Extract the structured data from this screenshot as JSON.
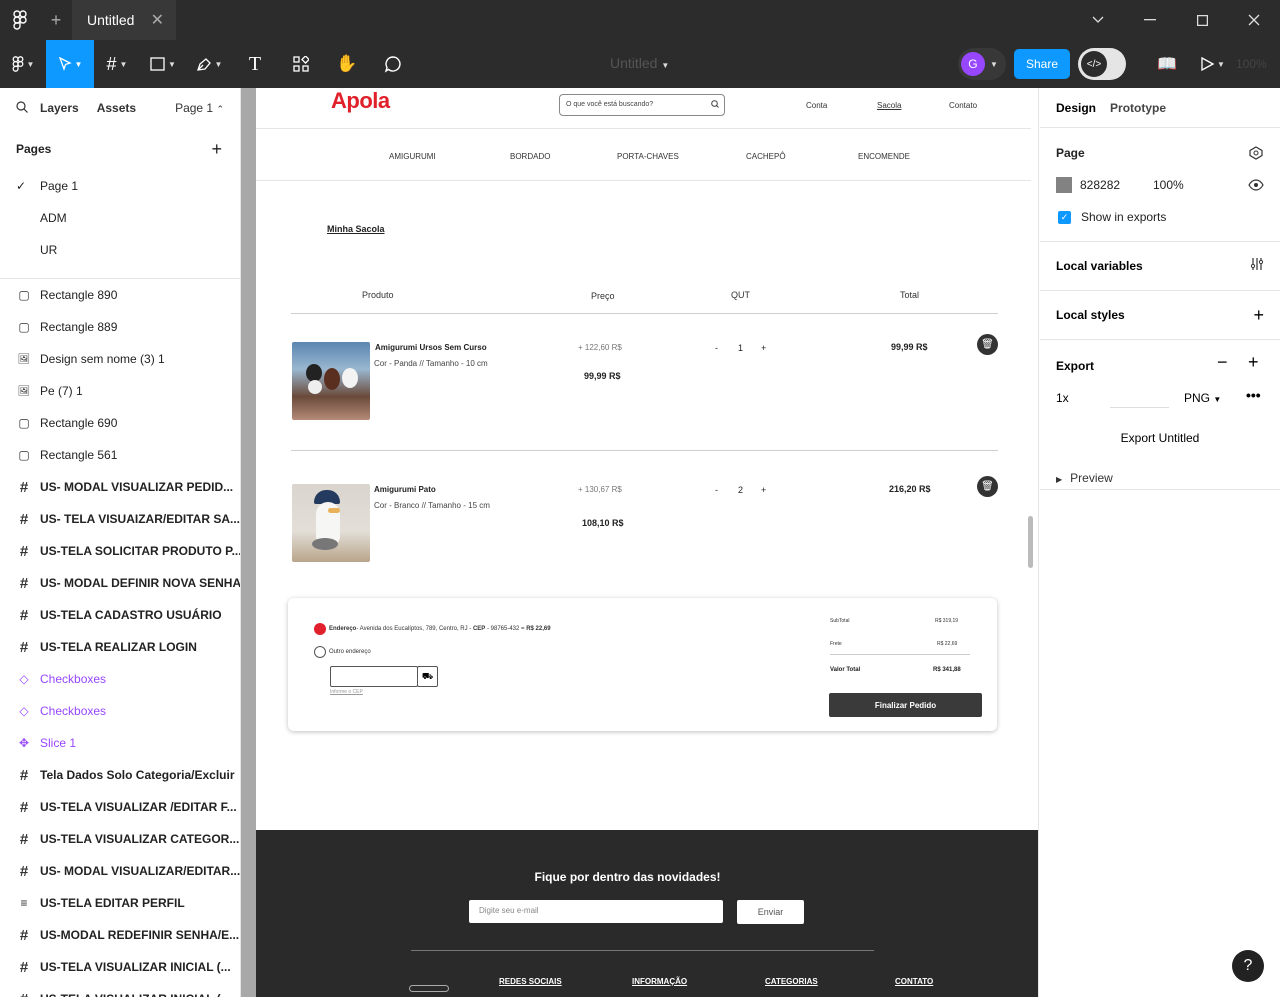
{
  "titlebar": {
    "tab_title": "Untitled",
    "tab_close": "✕",
    "new_tab": "+"
  },
  "toolbar": {
    "file_name": "Untitled",
    "zoom": "100%",
    "share": "Share",
    "avatar_initial": "G"
  },
  "left_panel": {
    "tabs": {
      "layers": "Layers",
      "assets": "Assets",
      "page": "Page 1"
    },
    "pages_header": "Pages",
    "pages": [
      {
        "label": "Page 1",
        "checked": true
      },
      {
        "label": "ADM",
        "checked": false
      },
      {
        "label": "UR",
        "checked": false
      }
    ],
    "layers": [
      {
        "label": "Rectangle 890",
        "type": "rect"
      },
      {
        "label": "Rectangle 889",
        "type": "rect"
      },
      {
        "label": "Design sem nome (3) 1",
        "type": "image"
      },
      {
        "label": "Pe (7) 1",
        "type": "image"
      },
      {
        "label": "Rectangle 690",
        "type": "rect"
      },
      {
        "label": "Rectangle 561",
        "type": "rect"
      },
      {
        "label": "US- MODAL VISUALIZAR PEDID...",
        "type": "frame"
      },
      {
        "label": "US- TELA VISUAIZAR/EDITAR SA...",
        "type": "frame"
      },
      {
        "label": "US-TELA SOLICITAR PRODUTO P...",
        "type": "frame"
      },
      {
        "label": "US- MODAL DEFINIR NOVA SENHA",
        "type": "frame"
      },
      {
        "label": "US-TELA CADASTRO USUÁRIO",
        "type": "frame"
      },
      {
        "label": "US-TELA REALIZAR LOGIN",
        "type": "frame"
      },
      {
        "label": "Checkboxes",
        "type": "component"
      },
      {
        "label": "Checkboxes",
        "type": "component"
      },
      {
        "label": "Slice 1",
        "type": "slice"
      },
      {
        "label": "Tela Dados Solo Categoria/Excluir",
        "type": "frame"
      },
      {
        "label": "US-TELA VISUALIZAR /EDITAR F...",
        "type": "frame"
      },
      {
        "label": "US-TELA VISUALIZAR CATEGOR...",
        "type": "frame"
      },
      {
        "label": "US- MODAL VISUALIZAR/EDITAR...",
        "type": "frame"
      },
      {
        "label": "US-TELA EDITAR PERFIL",
        "type": "text"
      },
      {
        "label": "US-MODAL REDEFINIR SENHA/E...",
        "type": "frame"
      },
      {
        "label": "US-TELA VISUALIZAR INICIAL (...",
        "type": "frame"
      },
      {
        "label": "US-TELA VISUALIZAR INICIAL (...",
        "type": "frame"
      }
    ]
  },
  "right_panel": {
    "tabs": {
      "design": "Design",
      "prototype": "Prototype"
    },
    "page_label": "Page",
    "bg_hex": "828282",
    "bg_opacity": "100%",
    "show_in_exports": "Show in exports",
    "local_variables": "Local variables",
    "local_styles": "Local styles",
    "export_label": "Export",
    "export_scale": "1x",
    "export_format": "PNG",
    "export_button": "Export Untitled",
    "preview": "Preview"
  },
  "site": {
    "logo": "Apola",
    "search_placeholder": "O que você está buscando?",
    "nav": [
      "Conta",
      "Sacola",
      "Contato"
    ],
    "categories": [
      "AMIGURUMI",
      "BORDADO",
      "PORTA-CHAVES",
      "CACHEPÔ",
      "ENCOMENDE"
    ],
    "page_title": "Minha Sacola",
    "columns": [
      "Produto",
      "Preço",
      "QUT",
      "Total"
    ],
    "items": [
      {
        "name": "Amigurumi  Ursos Sem Curso",
        "desc": "Cor - Panda // Tamanho - 10 cm",
        "old_price": "+ 122,60 R$",
        "price": "99,99 R$",
        "qty": "1",
        "total": "99,99 R$"
      },
      {
        "name": "Amigurumi  Pato",
        "desc": "Cor - Branco // Tamanho - 15 cm",
        "old_price": "+ 130,67 R$",
        "price": "108,10 R$",
        "qty": "2",
        "total": "216,20 R$"
      }
    ],
    "qty_minus": "-",
    "qty_plus": "+",
    "address_label": "Endereço",
    "address_text": "- Avenida dos Eucalíptos, 789, Centro, RJ - ",
    "cep_label": "CEP",
    "cep_text": " - 98765-432 = ",
    "address_price": "R$ 22,69",
    "other_address": "Outro endereço",
    "cep_hint": "Informe o CEP",
    "summary": [
      {
        "label": "SubTotal",
        "value": "R$ 319,19"
      },
      {
        "label": "Frete",
        "value": "R$ 22,69"
      },
      {
        "label": "Valor Total",
        "value": "R$ 341,88"
      }
    ],
    "checkout_button": "Finalizar Pedido",
    "footer": {
      "newsletter_title": "Fique por dentro das novidades!",
      "email_placeholder": "Digite seu e-mail",
      "send_button": "Enviar",
      "columns": [
        "REDES SOCIAIS",
        "INFORMAÇÃO",
        "CATEGORIAS",
        "CONTATO"
      ]
    }
  },
  "colors": {
    "accent": "#0d99ff",
    "brand_red": "#e0202a",
    "component_purple": "#9747ff",
    "dark": "#2c2c2c"
  }
}
